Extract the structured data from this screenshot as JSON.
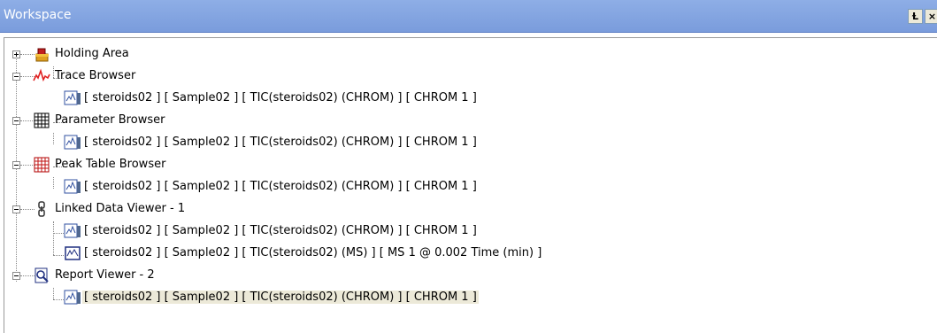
{
  "window": {
    "title": "Workspace",
    "pin_glyph": "Ɫ",
    "close_glyph": "×"
  },
  "tree": {
    "holding_area": "Holding Area",
    "trace_browser": "Trace Browser",
    "trace_browser_item": "[ steroids02 ] [ Sample02 ] [ TIC(steroids02) (CHROM) ] [ CHROM 1 ]",
    "parameter_browser": "Parameter Browser",
    "parameter_browser_item": "[ steroids02 ] [ Sample02 ] [ TIC(steroids02) (CHROM) ] [ CHROM 1 ]",
    "peak_table_browser": "Peak Table Browser",
    "peak_table_item": "[ steroids02 ] [ Sample02 ] [ TIC(steroids02) (CHROM) ] [ CHROM 1 ]",
    "linked_data_viewer": "Linked Data Viewer - 1",
    "linked_item_1": "[ steroids02 ] [ Sample02 ] [ TIC(steroids02) (CHROM) ] [ CHROM 1 ]",
    "linked_item_2": "[ steroids02 ] [ Sample02 ] [ TIC(steroids02) (MS) ] [ MS 1 @ 0.002 Time (min) ]",
    "report_viewer": "Report Viewer - 2",
    "report_item": "[ steroids02 ] [ Sample02 ] [ TIC(steroids02) (CHROM) ] [ CHROM 1 ]"
  },
  "icons": {
    "holding_area": "holding-area-icon",
    "trace_browser": "trace-wave-icon",
    "parameter_browser": "grid-table-icon",
    "peak_table_browser": "peak-table-icon",
    "linked_data_viewer": "chain-link-icon",
    "report_viewer": "magnifier-report-icon",
    "chromatogram_doc": "chromatogram-document-icon",
    "spectrum_doc": "spectrum-document-icon"
  }
}
